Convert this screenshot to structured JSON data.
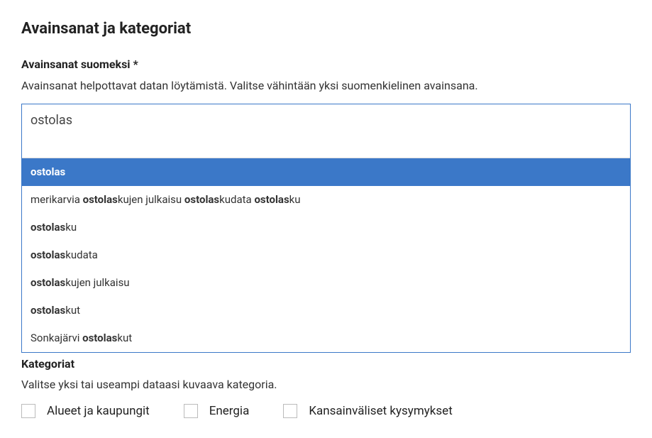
{
  "section": {
    "title": "Avainsanat ja kategoriat"
  },
  "keywords": {
    "label": "Avainsanat suomeksi *",
    "help": "Avainsanat helpottavat datan löytämistä. Valitse vähintään yksi suomenkielinen avainsana.",
    "input_value": "ostolas",
    "suggestions": [
      {
        "html": "ostolas",
        "active": true
      },
      {
        "html": "merikarvia <b>ostolas</b>kujen julkaisu <b>ostolas</b>kudata <b>ostolas</b>ku",
        "active": false
      },
      {
        "html": "<b>ostolas</b>ku",
        "active": false
      },
      {
        "html": "<b>ostolas</b>kudata",
        "active": false
      },
      {
        "html": "<b>ostolas</b>kujen julkaisu",
        "active": false
      },
      {
        "html": "<b>ostolas</b>kut",
        "active": false
      },
      {
        "html": "Sonkajärvi <b>ostolas</b>kut",
        "active": false
      }
    ]
  },
  "categories": {
    "label": "Kategoriat",
    "help": "Valitse yksi tai useampi dataasi kuvaava kategoria.",
    "items": [
      {
        "label": "Alueet ja kaupungit",
        "checked": false
      },
      {
        "label": "Energia",
        "checked": false
      },
      {
        "label": "Kansainväliset kysymykset",
        "checked": false
      }
    ]
  }
}
